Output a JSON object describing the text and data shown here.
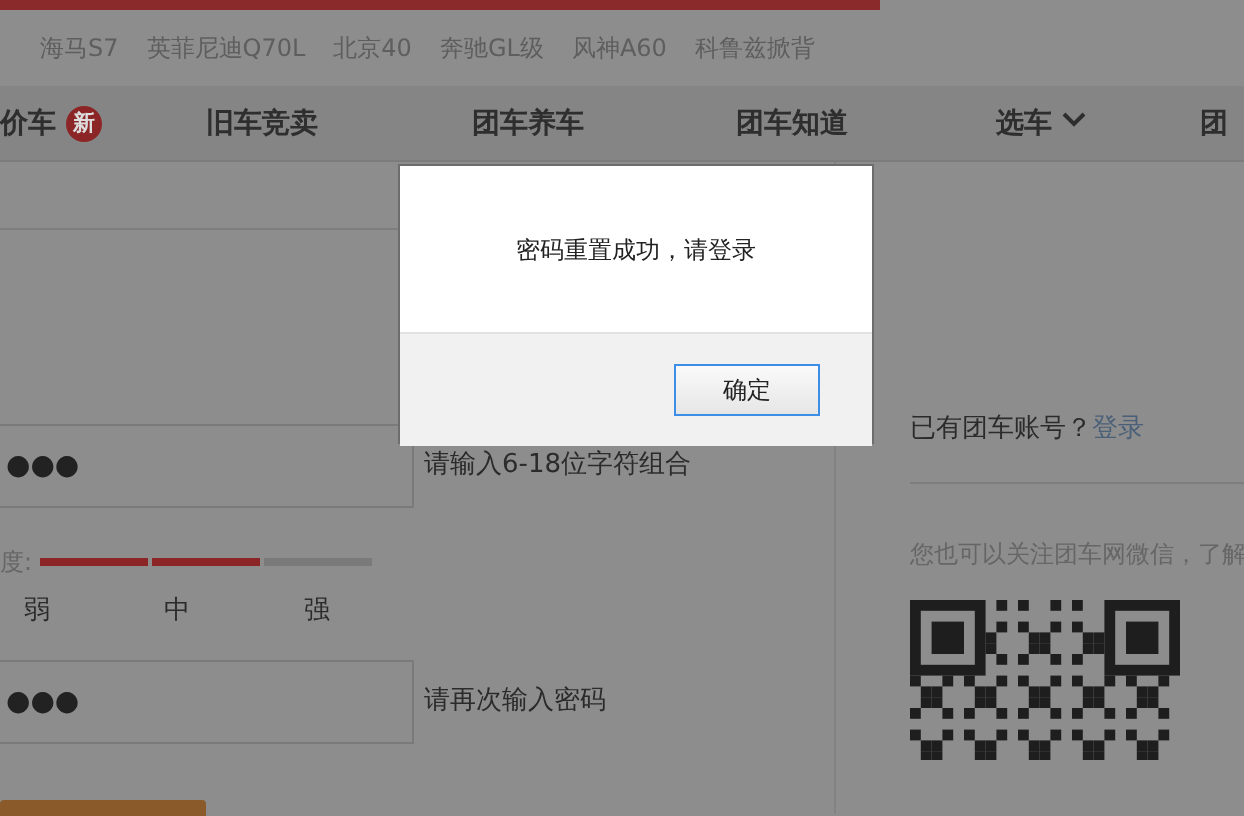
{
  "hot_search": [
    "海马S7",
    "英菲尼迪Q70L",
    "北京40",
    "奔驰GL级",
    "风神A60",
    "科鲁兹掀背"
  ],
  "nav": [
    {
      "label": "价车",
      "badge": "新",
      "dropdown": false
    },
    {
      "label": "旧车竞卖",
      "dropdown": false
    },
    {
      "label": "团车养车",
      "dropdown": false
    },
    {
      "label": "团车知道",
      "dropdown": false
    },
    {
      "label": "选车",
      "dropdown": true
    },
    {
      "label": "团",
      "dropdown": false
    }
  ],
  "form": {
    "password": {
      "value": "●●●",
      "hint": "请输入6-18位字符组合"
    },
    "strength": {
      "label": "度:",
      "level": 0.67,
      "levels": [
        "弱",
        "中",
        "强"
      ]
    },
    "confirm": {
      "value": "●●●",
      "hint": "请再次输入密码"
    }
  },
  "aside": {
    "account_text": "已有团车账号？",
    "login_link": "登录",
    "follow_text": "您也可以关注团车网微信，了解"
  },
  "dialog": {
    "message": "密码重置成功，请登录",
    "button": "确定"
  }
}
